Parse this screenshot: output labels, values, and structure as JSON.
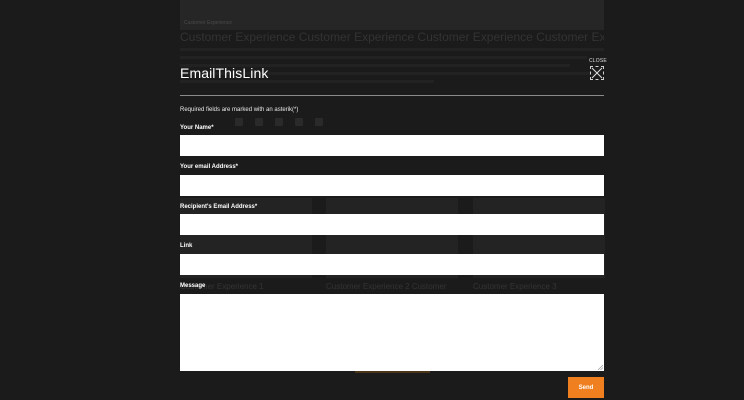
{
  "background_page": {
    "hero_caption": "Customer Experience",
    "headline": "Customer Experience Customer Experience Customer Experience Customer Experience",
    "thumbnails": [
      {
        "caption": "Customer Experience 1"
      },
      {
        "caption": "Customer Experience 2 Customer"
      },
      {
        "caption": "Customer Experience 3"
      }
    ]
  },
  "modal": {
    "title": "EmailThisLink",
    "close_label": "CLOSE",
    "required_note": "Required fields are marked with an asterik(*)",
    "fields": {
      "your_name": {
        "label": "Your Name*",
        "value": ""
      },
      "your_email": {
        "label": "Your email Address*",
        "value": ""
      },
      "recipient_email": {
        "label": "Recipient's Email Address*",
        "value": ""
      },
      "link": {
        "label": "Link",
        "value": ""
      },
      "message": {
        "label": "Message",
        "value": ""
      }
    },
    "send_label": "Send"
  },
  "colors": {
    "overlay": "#1b1b1b",
    "accent": "#f0801f",
    "text": "#ffffff",
    "input_bg": "#ffffff"
  }
}
